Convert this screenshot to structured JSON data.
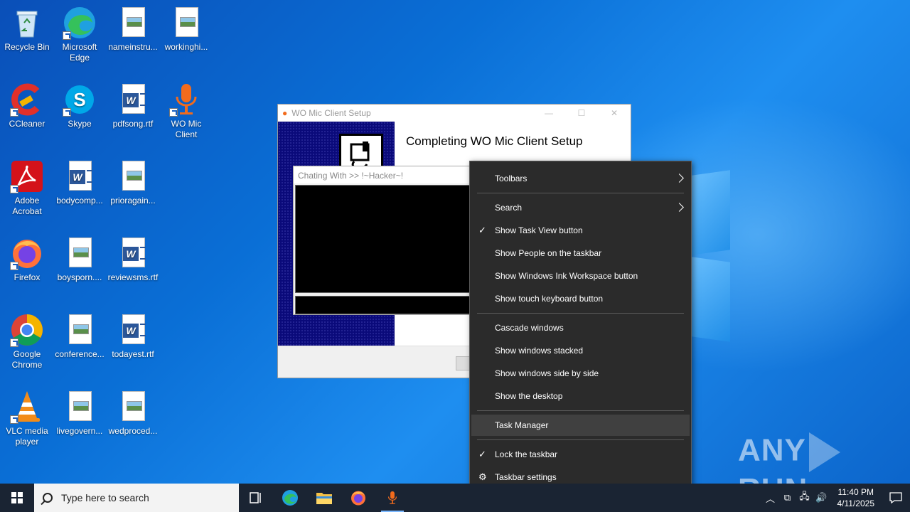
{
  "desktop": {
    "icons": [
      {
        "label": "Recycle Bin"
      },
      {
        "label": "Microsoft Edge"
      },
      {
        "label": "nameinstru..."
      },
      {
        "label": "workinghi..."
      },
      {
        "label": "CCleaner"
      },
      {
        "label": "Skype"
      },
      {
        "label": "pdfsong.rtf"
      },
      {
        "label": "WO Mic Client"
      },
      {
        "label": "Adobe Acrobat"
      },
      {
        "label": "bodycomp..."
      },
      {
        "label": "prioragain..."
      },
      {
        "label": "Firefox"
      },
      {
        "label": "boysporn...."
      },
      {
        "label": "reviewsms.rtf"
      },
      {
        "label": "Google Chrome"
      },
      {
        "label": "conference..."
      },
      {
        "label": "todayest.rtf"
      },
      {
        "label": "VLC media player"
      },
      {
        "label": "livegovern..."
      },
      {
        "label": "wedproced..."
      }
    ]
  },
  "setup_window": {
    "title": "WO Mic Client Setup",
    "heading": "Completing WO Mic Client Setup"
  },
  "chat_window": {
    "title": "Chating With >> !~Hacker~!"
  },
  "context_menu": {
    "items": [
      {
        "label": "Toolbars",
        "checked": false,
        "submenu": true
      },
      {
        "label": "Search",
        "checked": false,
        "submenu": true
      },
      {
        "label": "Show Task View button",
        "checked": true
      },
      {
        "label": "Show People on the taskbar",
        "checked": false
      },
      {
        "label": "Show Windows Ink Workspace button",
        "checked": false
      },
      {
        "label": "Show touch keyboard button",
        "checked": false
      },
      {
        "label": "Cascade windows",
        "checked": false
      },
      {
        "label": "Show windows stacked",
        "checked": false
      },
      {
        "label": "Show windows side by side",
        "checked": false
      },
      {
        "label": "Show the desktop",
        "checked": false
      },
      {
        "label": "Task Manager",
        "checked": false,
        "highlighted": true
      },
      {
        "label": "Lock the taskbar",
        "checked": true
      },
      {
        "label": "Taskbar settings",
        "checked": false
      }
    ]
  },
  "watermark": {
    "text_left": "ANY",
    "text_right": "RUN"
  },
  "taskbar": {
    "search_placeholder": "Type here to search",
    "pinned": [
      "task-view-icon",
      "edge-icon",
      "file-explorer-icon",
      "firefox-icon",
      "wo-mic-icon"
    ],
    "clock_time": "11:40 PM",
    "clock_date": "4/11/2025"
  },
  "colors": {
    "taskbar": "#1a2433",
    "menu_bg": "#2b2b2b",
    "menu_highlight": "#404040",
    "desktop": "#0a6fd6"
  }
}
